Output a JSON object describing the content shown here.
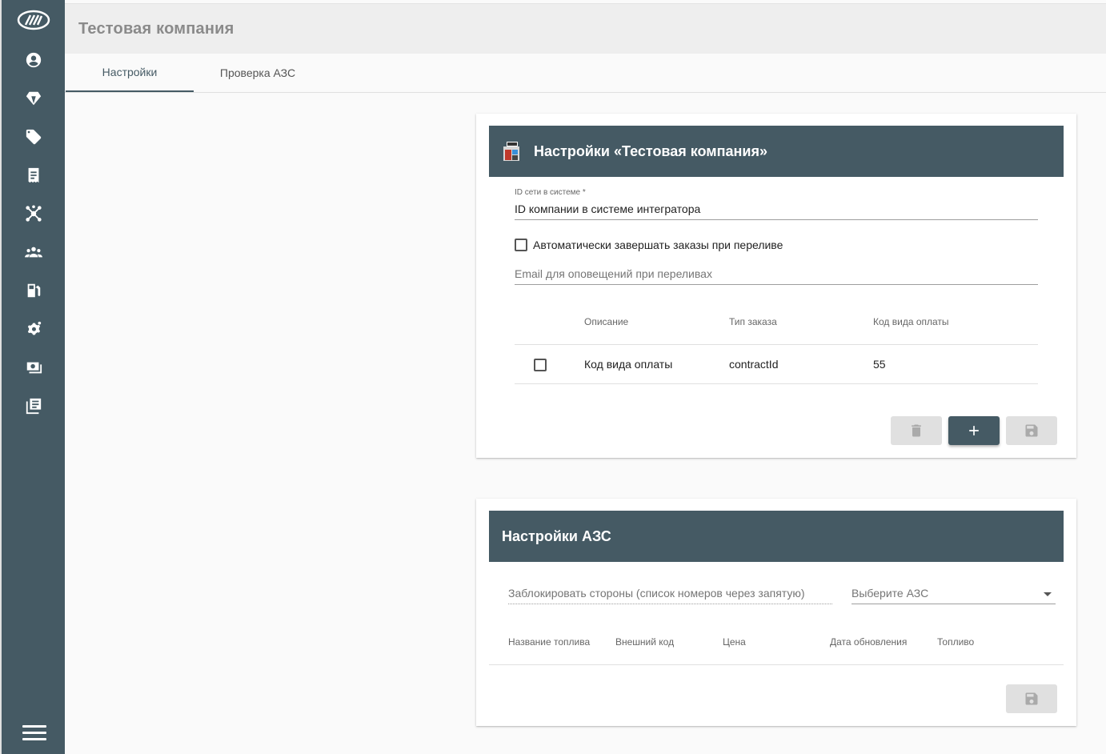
{
  "header": {
    "title": "Тестовая компания"
  },
  "tabs": [
    {
      "label": "Настройки",
      "active": true
    },
    {
      "label": "Проверка АЗС",
      "active": false
    }
  ],
  "sidebar": {
    "items": [
      {
        "icon": "account-icon"
      },
      {
        "icon": "diamond-icon"
      },
      {
        "icon": "tag-icon"
      },
      {
        "icon": "receipt-icon"
      },
      {
        "icon": "network-icon"
      },
      {
        "icon": "group-icon"
      },
      {
        "icon": "fuel-pump-icon"
      },
      {
        "icon": "settings-icon"
      },
      {
        "icon": "cash-icon"
      },
      {
        "icon": "library-icon"
      }
    ],
    "menu_icon": "menu-icon"
  },
  "company_settings": {
    "title": "Настройки «Тестовая компания»",
    "network_id_label": "ID сети в системе *",
    "network_id_value": "ID компании в системе интегратора",
    "auto_complete_label": "Автоматически завершать заказы при переливе",
    "auto_complete_checked": false,
    "email_placeholder": "Email для оповещений при переливах",
    "table": {
      "headers": [
        "Описание",
        "Тип заказа",
        "Код вида оплаты"
      ],
      "rows": [
        {
          "checked": false,
          "description": "Код вида оплаты",
          "order_type": "contractId",
          "payment_code": "55"
        }
      ]
    },
    "buttons": [
      "delete-icon",
      "add-icon",
      "save-icon"
    ]
  },
  "station_settings": {
    "title": "Настройки АЗС",
    "block_sides_placeholder": "Заблокировать стороны (список номеров через запятую)",
    "select_station_placeholder": "Выберите АЗС",
    "table": {
      "headers": [
        "Название топлива",
        "Внешний код",
        "Цена",
        "Дата обновления",
        "Топливо"
      ]
    }
  },
  "colors": {
    "primary": "#455a64",
    "background": "#fafafa",
    "disabled": "#e0e0e0"
  }
}
